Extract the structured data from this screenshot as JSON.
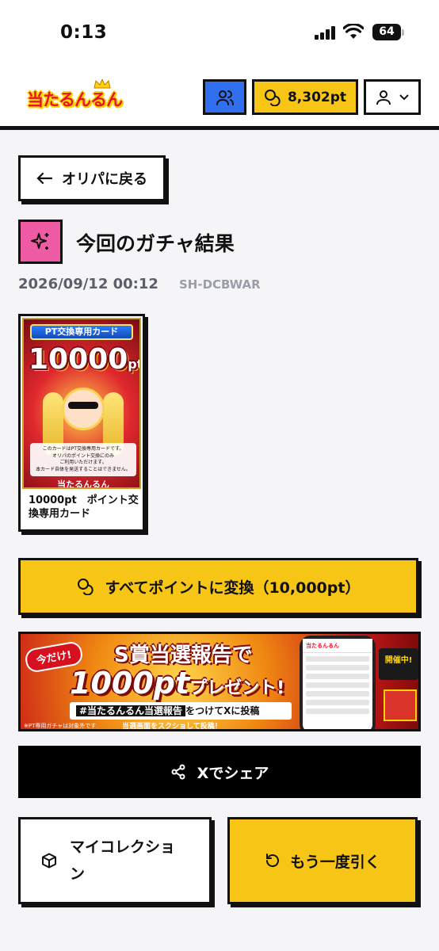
{
  "status_bar": {
    "time": "0:13",
    "battery": "64"
  },
  "header": {
    "logo_text": "当たるんるん",
    "points": "8,302pt"
  },
  "back_button": {
    "label": "オリパに戻る"
  },
  "result": {
    "title": "今回のガチャ結果",
    "date": "2026/09/12 00:12",
    "code": "SH-DCBWAR"
  },
  "card": {
    "banner": "PT交換専用カード",
    "amount": "10000",
    "unit": "pt",
    "note_lines": [
      "このカードはPT交換専用カードです。",
      "オリパのポイント交換にのみ",
      "ご利用いただけます。",
      "本カード自体を発送することはできません。"
    ],
    "brand": "当たるんるん",
    "name": "10000pt　ポイント交換専用カード"
  },
  "convert_button": {
    "label": "すべてポイントに変換（10,000pt）"
  },
  "promo": {
    "tag": "今だけ!",
    "line1": "S賞当選報告で",
    "amount": "1000pt",
    "line2_suffix": "プレゼント!",
    "hashtag": "#当たるんるん当選報告",
    "hash_suffix": "をつけてXに投稿",
    "sub": "当選画面をスクショして投稿！",
    "note": "※PT専用ガチャは対象外です",
    "badge": "開催中!",
    "phone_title": "当たるんるん"
  },
  "share_button": {
    "label": "Xでシェア"
  },
  "collection_button": {
    "label": "マイコレクション"
  },
  "again_button": {
    "label": "もう一度引く"
  },
  "colors": {
    "accent_yellow": "#f6c515",
    "accent_blue": "#2f6ff0",
    "accent_pink": "#ef5aa5",
    "logo_red": "#e8132b"
  }
}
